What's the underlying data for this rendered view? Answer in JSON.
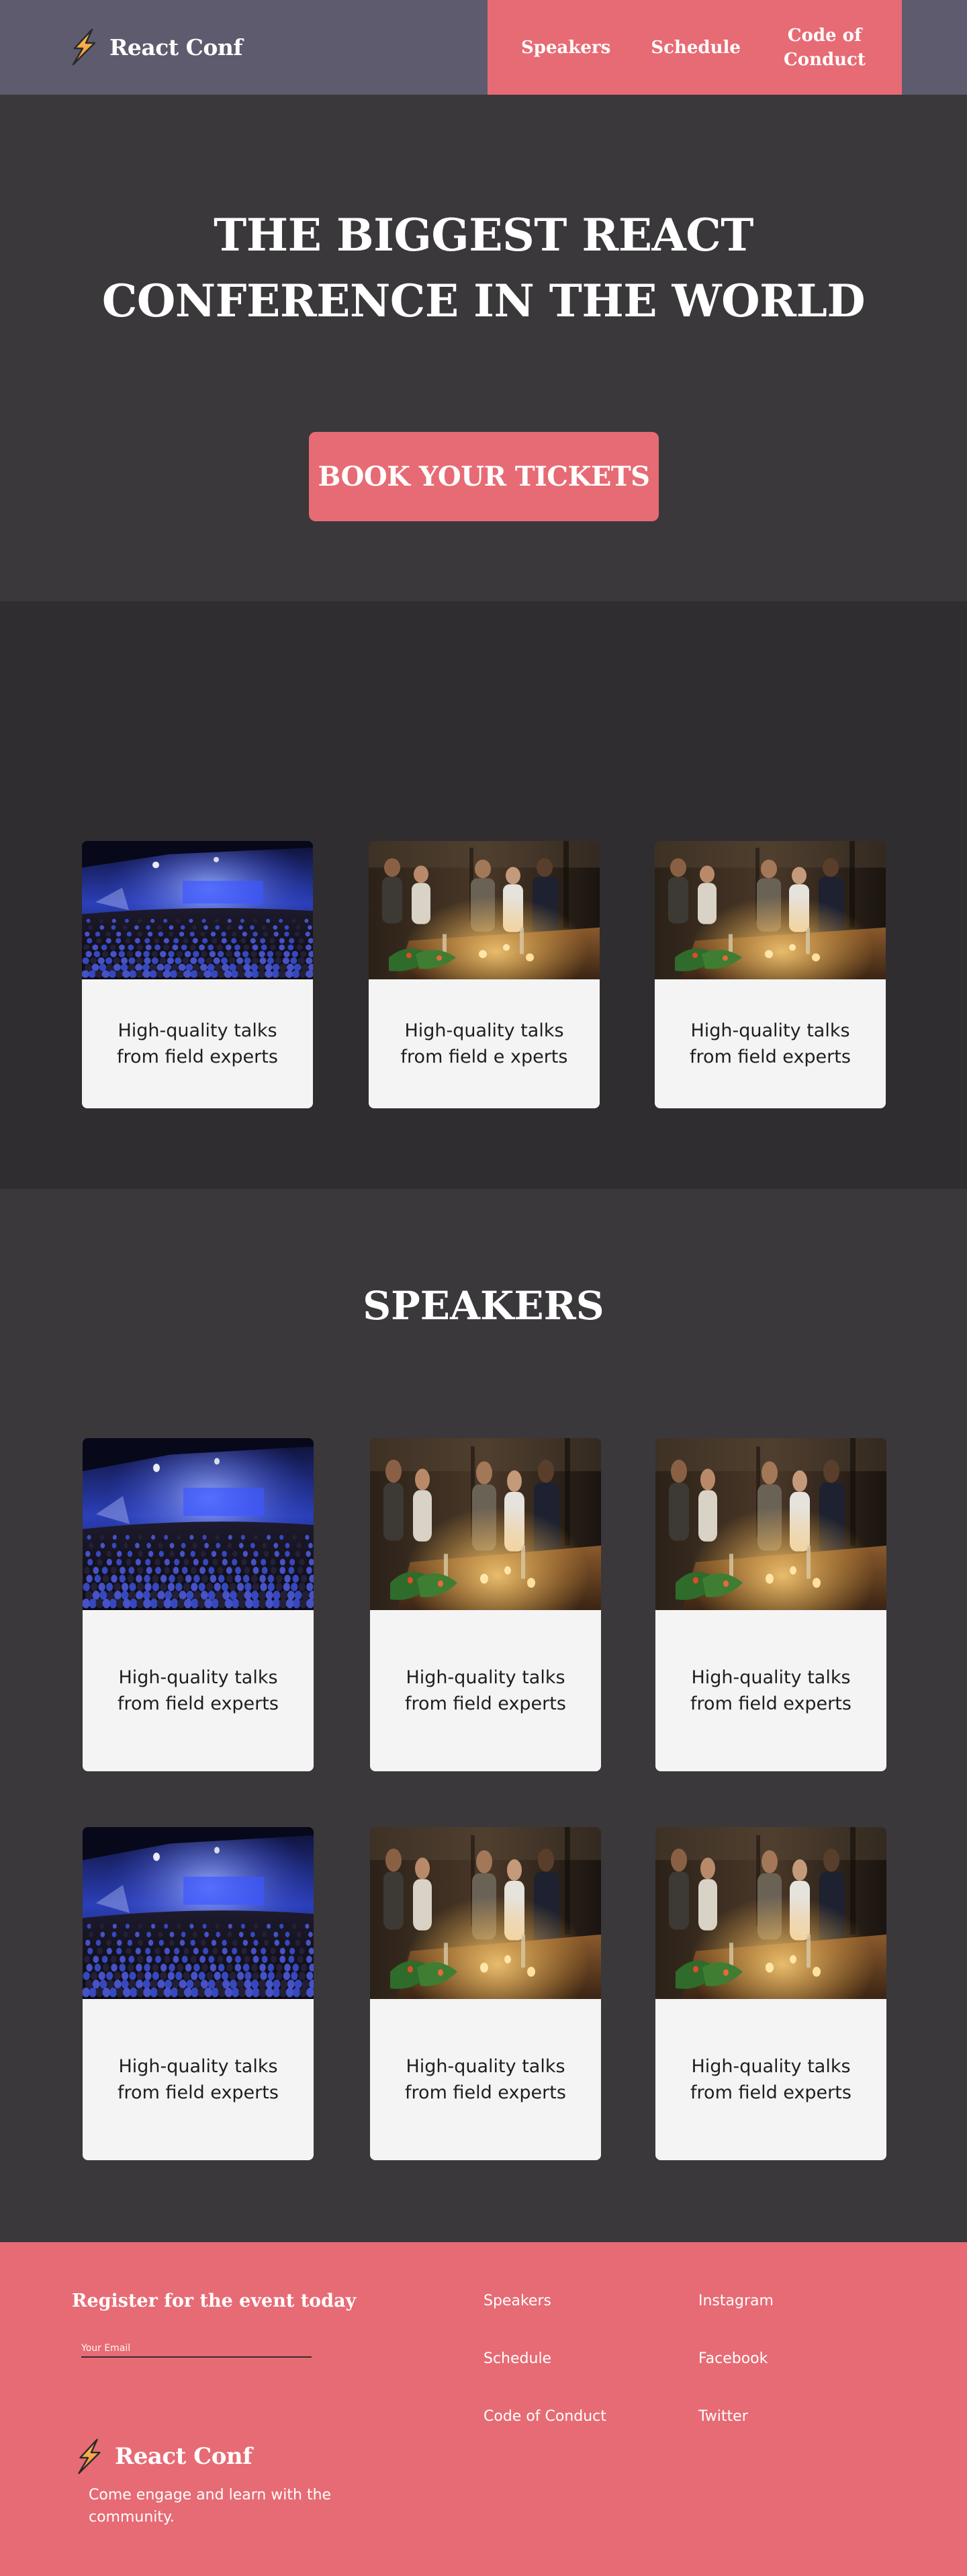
{
  "nav": {
    "brand": "React Conf",
    "links": [
      "Speakers",
      "Schedule",
      "Code of\nConduct"
    ]
  },
  "hero": {
    "title": "THE BIGGEST REACT\nCONFERENCE IN THE WORLD",
    "cta_label": "BOOK YOUR TICKETS"
  },
  "features": {
    "cards": [
      {
        "text": "High-quality talks from field experts",
        "photo": "auditorium-photo"
      },
      {
        "text": "High-quality talks from field e xperts",
        "photo": "networking-photo"
      },
      {
        "text": "High-quality talks from field experts",
        "photo": "networking-photo"
      }
    ]
  },
  "speakers": {
    "title": "SPEAKERS",
    "cards": [
      {
        "text": "High-quality talks from field experts",
        "photo": "auditorium-photo"
      },
      {
        "text": "High-quality talks from field experts",
        "photo": "networking-photo"
      },
      {
        "text": "High-quality talks from field experts",
        "photo": "networking-photo"
      },
      {
        "text": "High-quality talks from field experts",
        "photo": "auditorium-photo"
      },
      {
        "text": "High-quality talks from field experts",
        "photo": "networking-photo"
      },
      {
        "text": "High-quality talks from field experts",
        "photo": "networking-photo"
      }
    ]
  },
  "footer": {
    "register_title": "Register for the event today",
    "email_placeholder": "Your Email",
    "brand": "React Conf",
    "tagline": "Come engage and learn with the community.",
    "links_col1": [
      "Speakers",
      "Schedule",
      "Code of Conduct"
    ],
    "links_col2": [
      "Instagram",
      "Facebook",
      "Twitter"
    ]
  },
  "colors": {
    "accent": "#e76b74",
    "nav_bg": "#5e5b6e",
    "dark_bg": "#3a383a",
    "darker_bg": "#2f2d2f",
    "card_bg": "#f4f4f4"
  }
}
